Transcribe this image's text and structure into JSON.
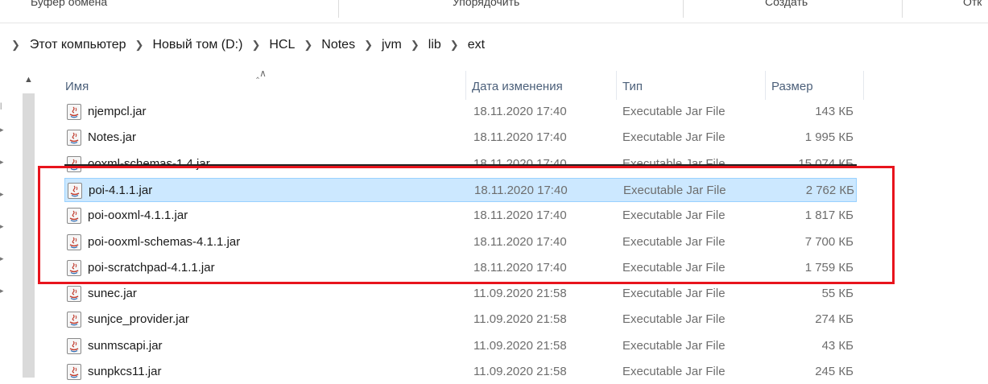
{
  "ribbon": {
    "groups": [
      "Буфер обмена",
      "Упорядочить",
      "Создать",
      "Отк"
    ]
  },
  "address": {
    "crumbs": [
      "Этот компьютер",
      "Новый том (D:)",
      "HCL",
      "Notes",
      "jvm",
      "lib",
      "ext"
    ]
  },
  "columns": {
    "name": "Имя",
    "date": "Дата изменения",
    "type": "Тип",
    "size": "Размер"
  },
  "files": [
    {
      "name": "njempcl.jar",
      "date": "18.11.2020 17:40",
      "type": "Executable Jar File",
      "size": "143 КБ"
    },
    {
      "name": "Notes.jar",
      "date": "18.11.2020 17:40",
      "type": "Executable Jar File",
      "size": "1 995 КБ"
    },
    {
      "name": "ooxml-schemas-1.4.jar",
      "date": "18.11.2020 17:40",
      "type": "Executable Jar File",
      "size": "15 074 КБ"
    },
    {
      "name": "poi-4.1.1.jar",
      "date": "18.11.2020 17:40",
      "type": "Executable Jar File",
      "size": "2 762 КБ"
    },
    {
      "name": "poi-ooxml-4.1.1.jar",
      "date": "18.11.2020 17:40",
      "type": "Executable Jar File",
      "size": "1 817 КБ"
    },
    {
      "name": "poi-ooxml-schemas-4.1.1.jar",
      "date": "18.11.2020 17:40",
      "type": "Executable Jar File",
      "size": "7 700 КБ"
    },
    {
      "name": "poi-scratchpad-4.1.1.jar",
      "date": "18.11.2020 17:40",
      "type": "Executable Jar File",
      "size": "1 759 КБ"
    },
    {
      "name": "sunec.jar",
      "date": "11.09.2020 21:58",
      "type": "Executable Jar File",
      "size": "55 КБ"
    },
    {
      "name": "sunjce_provider.jar",
      "date": "11.09.2020 21:58",
      "type": "Executable Jar File",
      "size": "274 КБ"
    },
    {
      "name": "sunmscapi.jar",
      "date": "11.09.2020 21:58",
      "type": "Executable Jar File",
      "size": "43 КБ"
    },
    {
      "name": "sunpkcs11.jar",
      "date": "11.09.2020 21:58",
      "type": "Executable Jar File",
      "size": "245 КБ"
    }
  ],
  "selected_file": "poi-4.1.1.jar",
  "struck_file": "ooxml-schemas-1.4.jar",
  "colors": {
    "selection": "#cce8ff",
    "highlight": "#e8141d",
    "header_text": "#4c607a"
  },
  "icons": {
    "file": "java-jar-icon",
    "breadcrumb_separator": "chevron-right-icon",
    "sort": "sort-ascending-icon"
  }
}
